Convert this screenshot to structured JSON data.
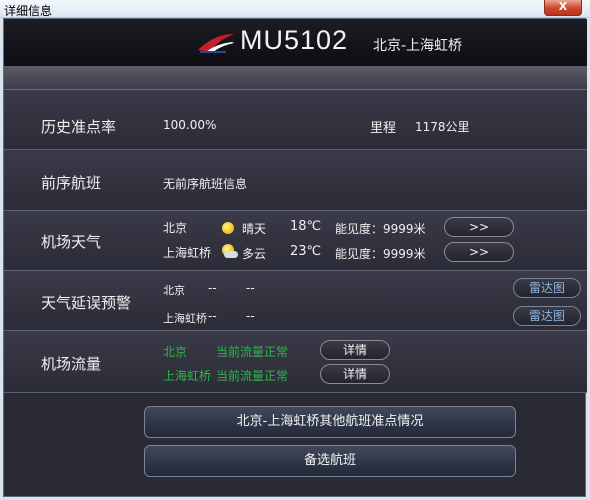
{
  "window": {
    "title": "详细信息",
    "close_label": "X"
  },
  "header": {
    "flight_no": "MU5102",
    "route": "北京-上海虹桥"
  },
  "ontime": {
    "label": "历史准点率",
    "value": "100.00%",
    "distance_label": "里程",
    "distance_value": "1178公里"
  },
  "previous_flight": {
    "label": "前序航班",
    "value": "无前序航班信息"
  },
  "weather": {
    "label": "机场天气",
    "airports": [
      {
        "city": "北京",
        "icon": "sun-icon",
        "condition": "晴天",
        "temp": "18℃",
        "visibility": "能见度：9999米",
        "button": ">>"
      },
      {
        "city": "上海虹桥",
        "icon": "partly-cloudy-icon",
        "condition": "多云",
        "temp": "23℃",
        "visibility": "能见度：9999米",
        "button": ">>"
      }
    ]
  },
  "delay_warning": {
    "label": "天气延误预警",
    "rows": [
      {
        "city": "北京",
        "v1": "--",
        "v2": "--",
        "button": "雷达图"
      },
      {
        "city": "上海虹桥",
        "v1": "--",
        "v2": "--",
        "button": "雷达图"
      }
    ]
  },
  "traffic": {
    "label": "机场流量",
    "rows": [
      {
        "city": "北京",
        "status": "当前流量正常",
        "button": "详情"
      },
      {
        "city": "上海虹桥",
        "status": "当前流量正常",
        "button": "详情"
      }
    ]
  },
  "actions": {
    "other_flights": "北京-上海虹桥其他航班准点情况",
    "alternate": "备选航班"
  },
  "colors": {
    "accent_green": "#2fb34a",
    "radar_blue": "#8fb4e0",
    "brand_red": "#c8202a"
  }
}
